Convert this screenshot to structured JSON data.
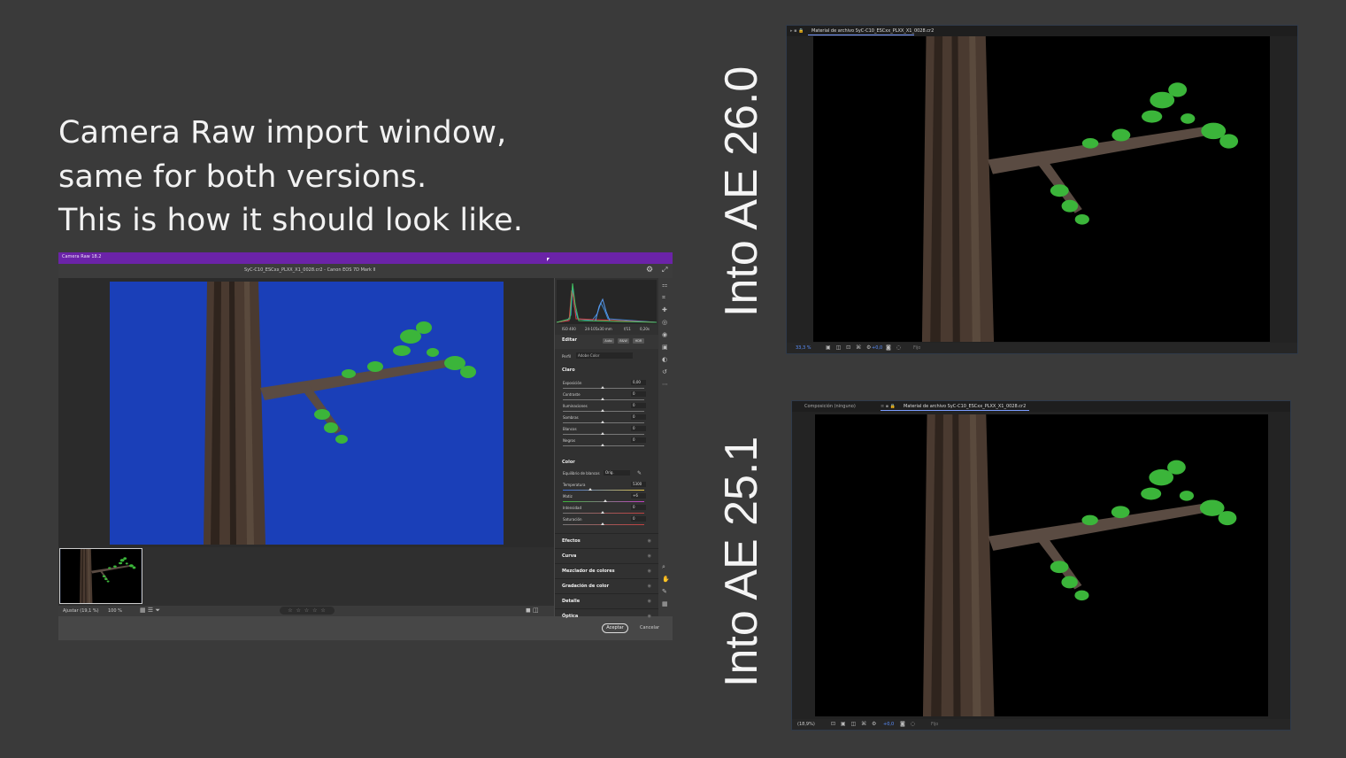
{
  "caption": {
    "line1": "Camera Raw import window,",
    "line2": "same for both versions.",
    "line3": "This is how it should look like."
  },
  "labels": {
    "ae26": "Into AE 26.0",
    "ae25": "Into AE 25.1"
  },
  "camera_raw": {
    "title": "Camera Raw 18.2",
    "file": "SyC-C10_ESCxx_PLXX_X1_0028.cr2 - Canon EOS 7D Mark II",
    "histogram_meta": {
      "iso": "ISO 400",
      "lens": "24-105x30 mm",
      "aperture": "f/11",
      "shutter": "0,20s"
    },
    "edit": {
      "label": "Editar",
      "auto": "Auto",
      "bw": "B&W",
      "hdr": "HDR"
    },
    "profile": {
      "label": "Perfil",
      "value": "Adobe Color"
    },
    "light": {
      "header": "Claro",
      "rows": [
        {
          "name": "Exposición",
          "value": "0,00"
        },
        {
          "name": "Contraste",
          "value": "0"
        },
        {
          "name": "Iluminaciones",
          "value": "0"
        },
        {
          "name": "Sombras",
          "value": "0"
        },
        {
          "name": "Blancos",
          "value": "0"
        },
        {
          "name": "Negros",
          "value": "0"
        }
      ]
    },
    "color": {
      "header": "Color",
      "wb_label": "Equilibrio de blancos",
      "wb_value": "Orig.",
      "rows": [
        {
          "name": "Temperatura",
          "value": "5300"
        },
        {
          "name": "Matiz",
          "value": "+6"
        },
        {
          "name": "Intensidad",
          "value": "0"
        },
        {
          "name": "Saturación",
          "value": "0"
        }
      ]
    },
    "collapsed_sections": [
      "Efectos",
      "Curva",
      "Mezclador de colores",
      "Gradación de color",
      "Detalle",
      "Óptica"
    ],
    "bottom": {
      "fit": "Ajustar (19,1 %)",
      "zoom": "100 %",
      "stars": "☆ ☆ ☆ ☆ ☆"
    },
    "footer": {
      "ok": "Aceptar",
      "cancel": "Cancelar"
    }
  },
  "ae26": {
    "tab": "Material de archivo SyC-C10_ESCxx_PLXX_X1_0028.cr2",
    "zoom": "33,3 %",
    "exposure": "+0,0",
    "resolution": "Fijo"
  },
  "ae25": {
    "tab_comp": "Composición (ninguno)",
    "tab": "Material de archivo SyC-C10_ESCxx_PLXX_X1_0028.cr2",
    "zoom": "(18,9%)",
    "exposure": "+0,0",
    "resolution": "Fijo"
  },
  "colors": {
    "cr_title_purple": "#6b23a8",
    "bg_blue_correct": "#1a3fb8",
    "bg_purple_wrong": "#4a2ab0",
    "background": "#3a3a3a"
  }
}
